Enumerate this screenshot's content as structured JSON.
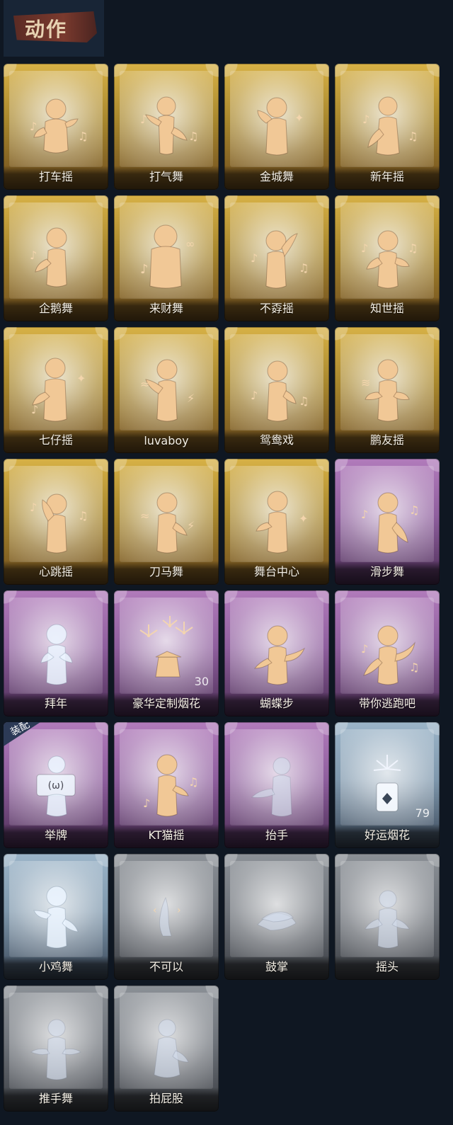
{
  "header": {
    "title": "动作"
  },
  "cards": [
    {
      "label": "打车摇",
      "rarity": "gold"
    },
    {
      "label": "打气舞",
      "rarity": "gold"
    },
    {
      "label": "金城舞",
      "rarity": "gold"
    },
    {
      "label": "新年摇",
      "rarity": "gold"
    },
    {
      "label": "企鹅舞",
      "rarity": "gold"
    },
    {
      "label": "来财舞",
      "rarity": "gold"
    },
    {
      "label": "不孬摇",
      "rarity": "gold"
    },
    {
      "label": "知世摇",
      "rarity": "gold"
    },
    {
      "label": "七仔摇",
      "rarity": "gold"
    },
    {
      "label": "luvaboy",
      "rarity": "gold"
    },
    {
      "label": "鸳鸯戏",
      "rarity": "gold"
    },
    {
      "label": "鹏友摇",
      "rarity": "gold"
    },
    {
      "label": "心跳摇",
      "rarity": "gold"
    },
    {
      "label": "刀马舞",
      "rarity": "gold"
    },
    {
      "label": "舞台中心",
      "rarity": "gold"
    },
    {
      "label": "滑步舞",
      "rarity": "purple"
    },
    {
      "label": "拜年",
      "rarity": "purple"
    },
    {
      "label": "豪华定制烟花",
      "rarity": "purple",
      "count": "30"
    },
    {
      "label": "蝴蝶步",
      "rarity": "purple"
    },
    {
      "label": "带你逃跑吧",
      "rarity": "purple"
    },
    {
      "label": "举牌",
      "rarity": "purple",
      "equipped_label": "装配"
    },
    {
      "label": "KT猫摇",
      "rarity": "purple"
    },
    {
      "label": "抬手",
      "rarity": "purple"
    },
    {
      "label": "好运烟花",
      "rarity": "blue",
      "count": "79"
    },
    {
      "label": "小鸡舞",
      "rarity": "blue"
    },
    {
      "label": "不可以",
      "rarity": "silver"
    },
    {
      "label": "鼓掌",
      "rarity": "silver"
    },
    {
      "label": "摇头",
      "rarity": "silver"
    },
    {
      "label": "推手舞",
      "rarity": "silver"
    },
    {
      "label": "拍屁股",
      "rarity": "silver"
    }
  ],
  "colors": {
    "gold": "#d7b146",
    "purple": "#b17bbb",
    "blue": "#9bb4c8",
    "silver": "#8b9096",
    "background": "#0f1722"
  }
}
